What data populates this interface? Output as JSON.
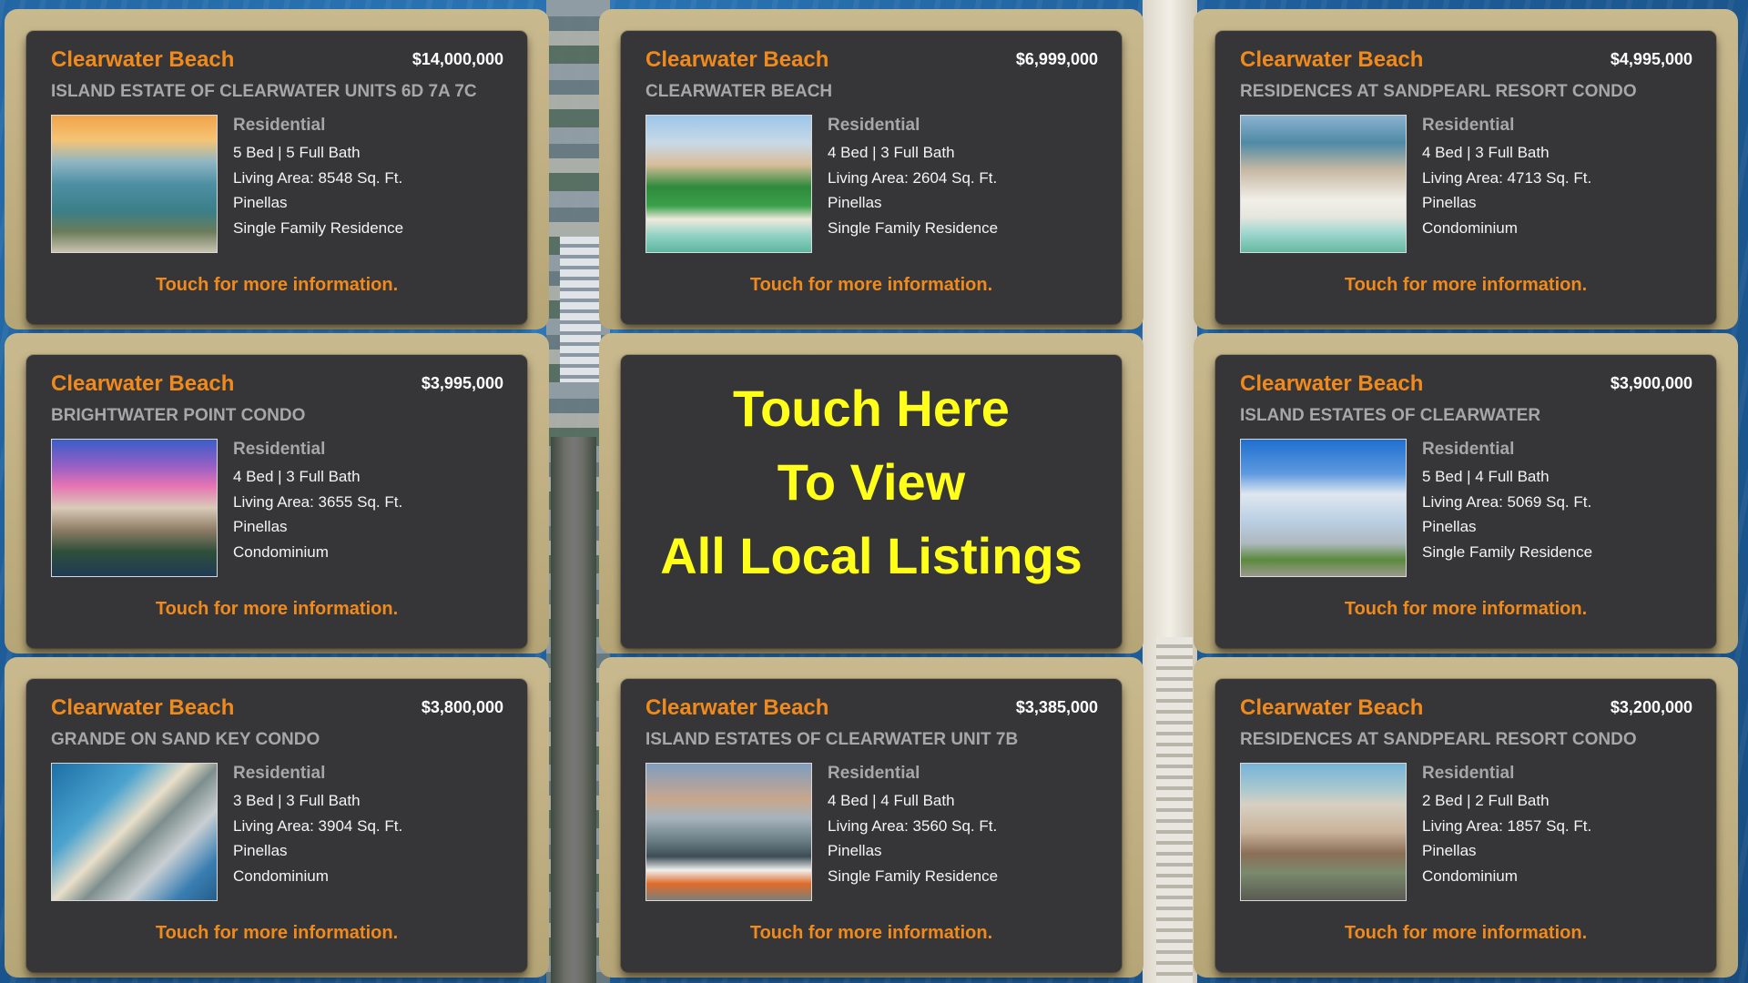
{
  "listings": [
    {
      "city": "Clearwater Beach",
      "price": "$14,000,000",
      "subdivision": "ISLAND ESTATE OF CLEARWATER UNITS 6D 7A 7C",
      "type": "Residential",
      "beds_baths": "5 Bed | 5 Full Bath",
      "living_area": "Living Area: 8548 Sq. Ft.",
      "county": "Pinellas",
      "property_type": "Single Family Residence",
      "cta": "Touch for more information."
    },
    {
      "city": "Clearwater Beach",
      "price": "$6,999,000",
      "subdivision": "CLEARWATER BEACH",
      "type": "Residential",
      "beds_baths": "4 Bed | 3 Full Bath",
      "living_area": "Living Area: 2604 Sq. Ft.",
      "county": "Pinellas",
      "property_type": "Single Family Residence",
      "cta": "Touch for more information."
    },
    {
      "city": "Clearwater Beach",
      "price": "$4,995,000",
      "subdivision": "RESIDENCES AT SANDPEARL RESORT CONDO",
      "type": "Residential",
      "beds_baths": "4 Bed | 3 Full Bath",
      "living_area": "Living Area: 4713 Sq. Ft.",
      "county": "Pinellas",
      "property_type": "Condominium",
      "cta": "Touch for more information."
    },
    {
      "city": "Clearwater Beach",
      "price": "$3,995,000",
      "subdivision": "BRIGHTWATER POINT CONDO",
      "type": "Residential",
      "beds_baths": "4 Bed | 3 Full Bath",
      "living_area": "Living Area: 3655 Sq. Ft.",
      "county": "Pinellas",
      "property_type": "Condominium",
      "cta": "Touch for more information."
    },
    {
      "city": "Clearwater Beach",
      "price": "$3,900,000",
      "subdivision": "ISLAND ESTATES OF CLEARWATER",
      "type": "Residential",
      "beds_baths": "5 Bed | 4 Full Bath",
      "living_area": "Living Area: 5069 Sq. Ft.",
      "county": "Pinellas",
      "property_type": "Single Family Residence",
      "cta": "Touch for more information."
    },
    {
      "city": "Clearwater Beach",
      "price": "$3,800,000",
      "subdivision": "GRANDE ON SAND KEY CONDO",
      "type": "Residential",
      "beds_baths": "3 Bed | 3 Full Bath",
      "living_area": "Living Area: 3904 Sq. Ft.",
      "county": "Pinellas",
      "property_type": "Condominium",
      "cta": "Touch for more information."
    },
    {
      "city": "Clearwater Beach",
      "price": "$3,385,000",
      "subdivision": "ISLAND ESTATES OF CLEARWATER UNIT 7B",
      "type": "Residential",
      "beds_baths": "4 Bed | 4 Full Bath",
      "living_area": "Living Area: 3560 Sq. Ft.",
      "county": "Pinellas",
      "property_type": "Single Family Residence",
      "cta": "Touch for more information."
    },
    {
      "city": "Clearwater Beach",
      "price": "$3,200,000",
      "subdivision": "RESIDENCES AT SANDPEARL RESORT CONDO",
      "type": "Residential",
      "beds_baths": "2 Bed | 2 Full Bath",
      "living_area": "Living Area: 1857 Sq. Ft.",
      "county": "Pinellas",
      "property_type": "Condominium",
      "cta": "Touch for more information."
    }
  ],
  "center_tile": {
    "line1": "Touch Here",
    "line2": "To View",
    "line3": "All Local Listings"
  },
  "colors": {
    "accent_orange": "#f08a1c",
    "highlight_yellow": "#ffff1a",
    "card_frame": "#bfae82",
    "card_body": "#363638"
  }
}
